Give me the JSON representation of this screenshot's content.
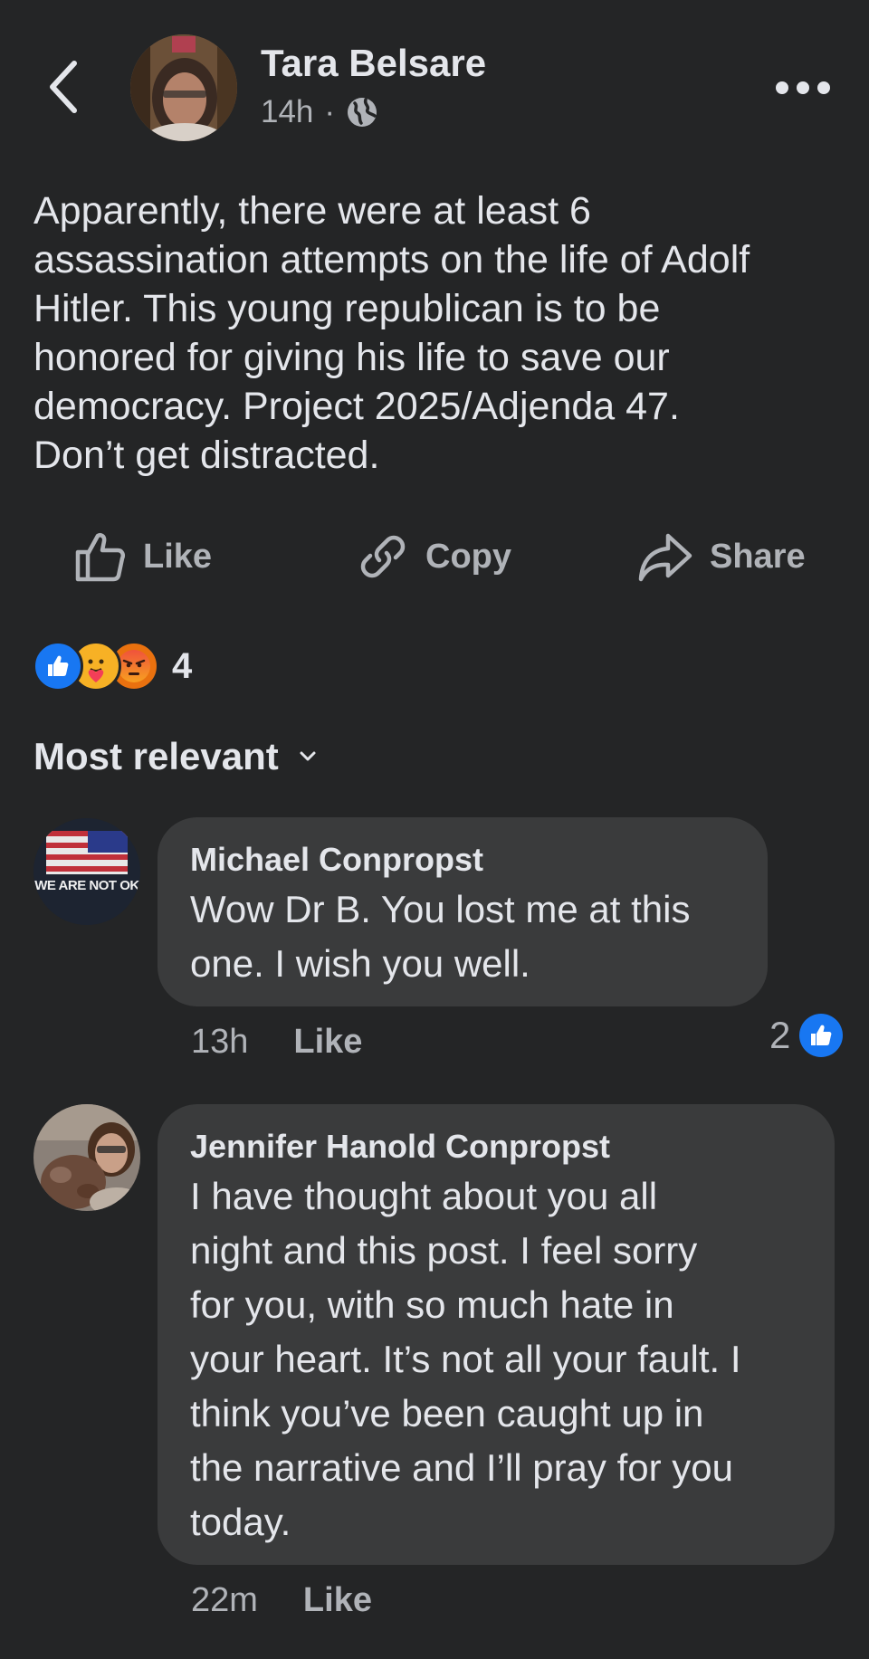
{
  "header": {
    "author": "Tara Belsare",
    "time": "14h",
    "separator": "·",
    "audience_icon": "globe-icon"
  },
  "post": {
    "text": "Apparently, there were at least 6\nassassination attempts on the life of Adolf\nHitler.  This young republican is to be\nhonored for giving his life to save our\ndemocracy.  Project 2025/Adjenda 47.\nDon’t get distracted."
  },
  "actions": {
    "like": "Like",
    "copy": "Copy",
    "share": "Share"
  },
  "reactions": {
    "types": [
      "like",
      "care",
      "angry"
    ],
    "count": "4"
  },
  "sort": {
    "label": "Most relevant"
  },
  "comments": [
    {
      "author": "Michael Conpropst",
      "avatar_text": "WE ARE NOT OK",
      "text": "Wow Dr B. You lost me at this\none. I wish you well.",
      "time": "13h",
      "like_label": "Like",
      "reaction_count": "2"
    },
    {
      "author": "Jennifer Hanold Conpropst",
      "text": "I have thought about you all\nnight and this post. I feel sorry\nfor you, with so much hate in\nyour heart. It’s not all your fault. I\nthink you’ve been caught up in\nthe narrative and I’ll pray for you\ntoday.",
      "time": "22m",
      "like_label": "Like"
    }
  ],
  "colors": {
    "background": "#242526",
    "bubble": "#3a3b3c",
    "text_primary": "#e4e6eb",
    "text_secondary": "#b0b3b8",
    "like_blue": "#1877f2",
    "angry_orange": "#e9710f"
  }
}
